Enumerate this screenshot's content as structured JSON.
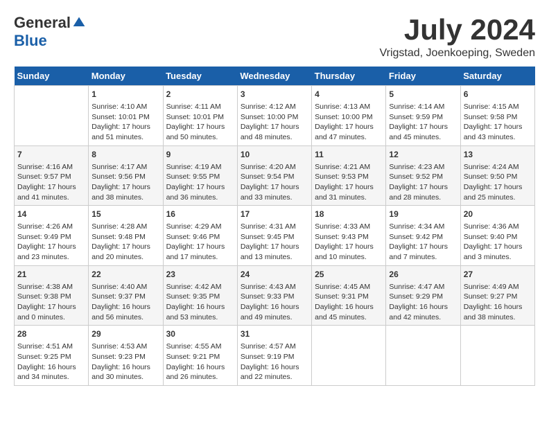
{
  "logo": {
    "general": "General",
    "blue": "Blue"
  },
  "header": {
    "month_year": "July 2024",
    "location": "Vrigstad, Joenkoeping, Sweden"
  },
  "weekdays": [
    "Sunday",
    "Monday",
    "Tuesday",
    "Wednesday",
    "Thursday",
    "Friday",
    "Saturday"
  ],
  "weeks": [
    [
      {
        "day": "",
        "sunrise": "",
        "sunset": "",
        "daylight": ""
      },
      {
        "day": "1",
        "sunrise": "Sunrise: 4:10 AM",
        "sunset": "Sunset: 10:01 PM",
        "daylight": "Daylight: 17 hours and 51 minutes."
      },
      {
        "day": "2",
        "sunrise": "Sunrise: 4:11 AM",
        "sunset": "Sunset: 10:01 PM",
        "daylight": "Daylight: 17 hours and 50 minutes."
      },
      {
        "day": "3",
        "sunrise": "Sunrise: 4:12 AM",
        "sunset": "Sunset: 10:00 PM",
        "daylight": "Daylight: 17 hours and 48 minutes."
      },
      {
        "day": "4",
        "sunrise": "Sunrise: 4:13 AM",
        "sunset": "Sunset: 10:00 PM",
        "daylight": "Daylight: 17 hours and 47 minutes."
      },
      {
        "day": "5",
        "sunrise": "Sunrise: 4:14 AM",
        "sunset": "Sunset: 9:59 PM",
        "daylight": "Daylight: 17 hours and 45 minutes."
      },
      {
        "day": "6",
        "sunrise": "Sunrise: 4:15 AM",
        "sunset": "Sunset: 9:58 PM",
        "daylight": "Daylight: 17 hours and 43 minutes."
      }
    ],
    [
      {
        "day": "7",
        "sunrise": "Sunrise: 4:16 AM",
        "sunset": "Sunset: 9:57 PM",
        "daylight": "Daylight: 17 hours and 41 minutes."
      },
      {
        "day": "8",
        "sunrise": "Sunrise: 4:17 AM",
        "sunset": "Sunset: 9:56 PM",
        "daylight": "Daylight: 17 hours and 38 minutes."
      },
      {
        "day": "9",
        "sunrise": "Sunrise: 4:19 AM",
        "sunset": "Sunset: 9:55 PM",
        "daylight": "Daylight: 17 hours and 36 minutes."
      },
      {
        "day": "10",
        "sunrise": "Sunrise: 4:20 AM",
        "sunset": "Sunset: 9:54 PM",
        "daylight": "Daylight: 17 hours and 33 minutes."
      },
      {
        "day": "11",
        "sunrise": "Sunrise: 4:21 AM",
        "sunset": "Sunset: 9:53 PM",
        "daylight": "Daylight: 17 hours and 31 minutes."
      },
      {
        "day": "12",
        "sunrise": "Sunrise: 4:23 AM",
        "sunset": "Sunset: 9:52 PM",
        "daylight": "Daylight: 17 hours and 28 minutes."
      },
      {
        "day": "13",
        "sunrise": "Sunrise: 4:24 AM",
        "sunset": "Sunset: 9:50 PM",
        "daylight": "Daylight: 17 hours and 25 minutes."
      }
    ],
    [
      {
        "day": "14",
        "sunrise": "Sunrise: 4:26 AM",
        "sunset": "Sunset: 9:49 PM",
        "daylight": "Daylight: 17 hours and 23 minutes."
      },
      {
        "day": "15",
        "sunrise": "Sunrise: 4:28 AM",
        "sunset": "Sunset: 9:48 PM",
        "daylight": "Daylight: 17 hours and 20 minutes."
      },
      {
        "day": "16",
        "sunrise": "Sunrise: 4:29 AM",
        "sunset": "Sunset: 9:46 PM",
        "daylight": "Daylight: 17 hours and 17 minutes."
      },
      {
        "day": "17",
        "sunrise": "Sunrise: 4:31 AM",
        "sunset": "Sunset: 9:45 PM",
        "daylight": "Daylight: 17 hours and 13 minutes."
      },
      {
        "day": "18",
        "sunrise": "Sunrise: 4:33 AM",
        "sunset": "Sunset: 9:43 PM",
        "daylight": "Daylight: 17 hours and 10 minutes."
      },
      {
        "day": "19",
        "sunrise": "Sunrise: 4:34 AM",
        "sunset": "Sunset: 9:42 PM",
        "daylight": "Daylight: 17 hours and 7 minutes."
      },
      {
        "day": "20",
        "sunrise": "Sunrise: 4:36 AM",
        "sunset": "Sunset: 9:40 PM",
        "daylight": "Daylight: 17 hours and 3 minutes."
      }
    ],
    [
      {
        "day": "21",
        "sunrise": "Sunrise: 4:38 AM",
        "sunset": "Sunset: 9:38 PM",
        "daylight": "Daylight: 17 hours and 0 minutes."
      },
      {
        "day": "22",
        "sunrise": "Sunrise: 4:40 AM",
        "sunset": "Sunset: 9:37 PM",
        "daylight": "Daylight: 16 hours and 56 minutes."
      },
      {
        "day": "23",
        "sunrise": "Sunrise: 4:42 AM",
        "sunset": "Sunset: 9:35 PM",
        "daylight": "Daylight: 16 hours and 53 minutes."
      },
      {
        "day": "24",
        "sunrise": "Sunrise: 4:43 AM",
        "sunset": "Sunset: 9:33 PM",
        "daylight": "Daylight: 16 hours and 49 minutes."
      },
      {
        "day": "25",
        "sunrise": "Sunrise: 4:45 AM",
        "sunset": "Sunset: 9:31 PM",
        "daylight": "Daylight: 16 hours and 45 minutes."
      },
      {
        "day": "26",
        "sunrise": "Sunrise: 4:47 AM",
        "sunset": "Sunset: 9:29 PM",
        "daylight": "Daylight: 16 hours and 42 minutes."
      },
      {
        "day": "27",
        "sunrise": "Sunrise: 4:49 AM",
        "sunset": "Sunset: 9:27 PM",
        "daylight": "Daylight: 16 hours and 38 minutes."
      }
    ],
    [
      {
        "day": "28",
        "sunrise": "Sunrise: 4:51 AM",
        "sunset": "Sunset: 9:25 PM",
        "daylight": "Daylight: 16 hours and 34 minutes."
      },
      {
        "day": "29",
        "sunrise": "Sunrise: 4:53 AM",
        "sunset": "Sunset: 9:23 PM",
        "daylight": "Daylight: 16 hours and 30 minutes."
      },
      {
        "day": "30",
        "sunrise": "Sunrise: 4:55 AM",
        "sunset": "Sunset: 9:21 PM",
        "daylight": "Daylight: 16 hours and 26 minutes."
      },
      {
        "day": "31",
        "sunrise": "Sunrise: 4:57 AM",
        "sunset": "Sunset: 9:19 PM",
        "daylight": "Daylight: 16 hours and 22 minutes."
      },
      {
        "day": "",
        "sunrise": "",
        "sunset": "",
        "daylight": ""
      },
      {
        "day": "",
        "sunrise": "",
        "sunset": "",
        "daylight": ""
      },
      {
        "day": "",
        "sunrise": "",
        "sunset": "",
        "daylight": ""
      }
    ]
  ]
}
